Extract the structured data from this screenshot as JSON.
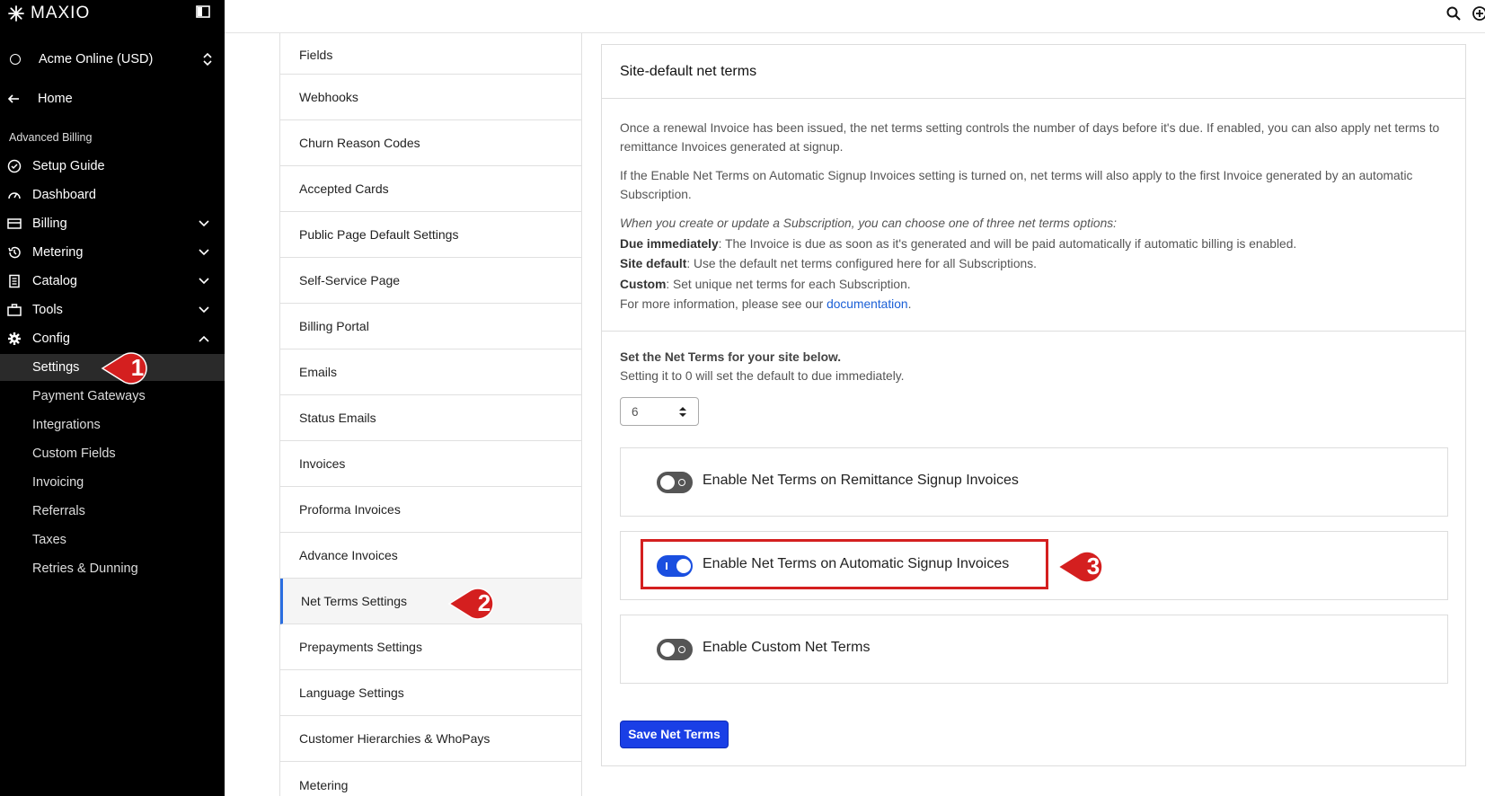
{
  "brand": {
    "name": "MAXIO"
  },
  "site_selector": {
    "label": "Acme Online (USD)"
  },
  "home": {
    "label": "Home"
  },
  "section": {
    "title": "Advanced Billing"
  },
  "nav": {
    "setup_guide": "Setup Guide",
    "dashboard": "Dashboard",
    "billing": "Billing",
    "metering": "Metering",
    "catalog": "Catalog",
    "tools": "Tools",
    "config": "Config"
  },
  "config_sub": [
    "Settings",
    "Payment Gateways",
    "Integrations",
    "Custom Fields",
    "Invoicing",
    "Referrals",
    "Taxes",
    "Retries & Dunning"
  ],
  "settings_list": [
    "Fields",
    "Webhooks",
    "Churn Reason Codes",
    "Accepted Cards",
    "Public Page Default Settings",
    "Self-Service Page",
    "Billing Portal",
    "Emails",
    "Status Emails",
    "Invoices",
    "Proforma Invoices",
    "Advance Invoices",
    "Net Terms Settings",
    "Prepayments Settings",
    "Language Settings",
    "Customer Hierarchies & WhoPays",
    "Metering"
  ],
  "panel": {
    "title": "Site-default net terms",
    "desc1": "Once a renewal Invoice has been issued, the net terms setting controls the number of days before it's due. If enabled, you can also apply net terms to remittance Invoices generated at signup.",
    "desc2": "If the Enable Net Terms on Automatic Signup Invoices setting is turned on, net terms will also apply to the first Invoice generated by an automatic Subscription.",
    "desc3": "When you create or update a Subscription, you can choose one of three net terms options:",
    "opt1_term": "Due immediately",
    "opt1_text": ": The Invoice is due as soon as it's generated and will be paid automatically if automatic billing is enabled.",
    "opt2_term": "Site default",
    "opt2_text": ": Use the default net terms configured here for all Subscriptions.",
    "opt3_term": "Custom",
    "opt3_text": ": Set unique net terms for each Subscription.",
    "more_info": "For more information, please see our ",
    "doc_link": "documentation",
    "period": ".",
    "net_title": "Set the Net Terms for your site below.",
    "net_sub": "Setting it to 0 will set the default to due immediately.",
    "net_value": "6",
    "toggle1": "Enable Net Terms on Remittance Signup Invoices",
    "toggle1_on": false,
    "toggle2": "Enable Net Terms on Automatic Signup Invoices",
    "toggle2_on": true,
    "toggle3": "Enable Custom Net Terms",
    "toggle3_on": false,
    "save": "Save Net Terms"
  },
  "markers": [
    "1",
    "2",
    "3"
  ],
  "colors": {
    "accent": "#1a3fe6",
    "marker": "#d41f1f",
    "sidebar": "#000000"
  }
}
